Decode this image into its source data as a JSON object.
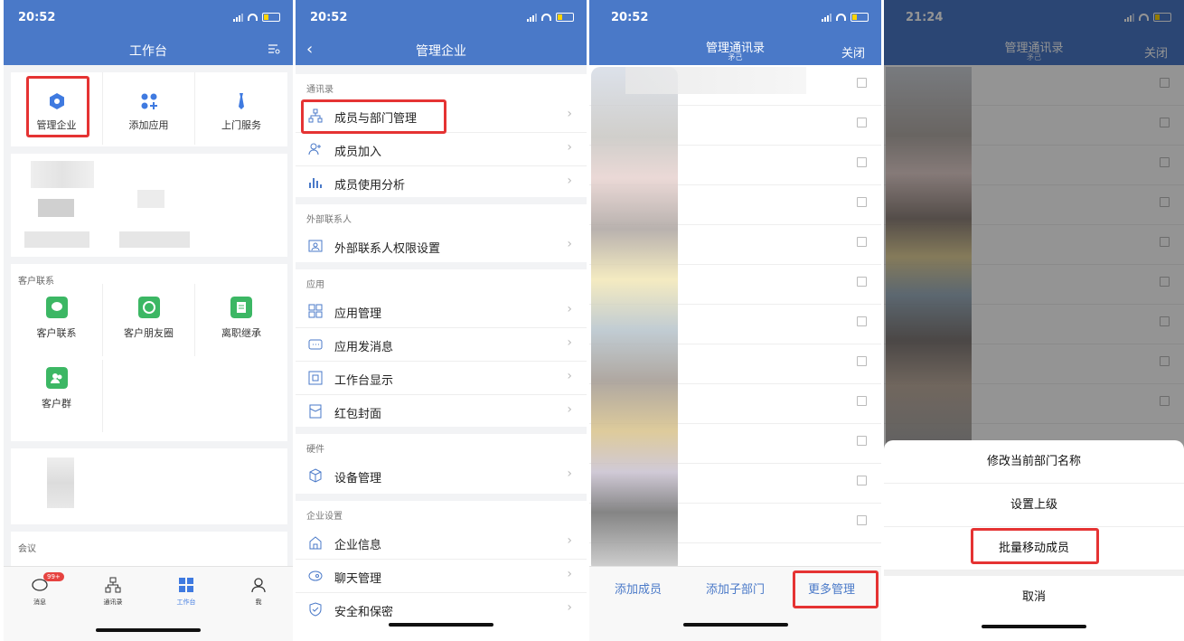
{
  "colors": {
    "accent": "#4a79c8",
    "highlight": "#e53333",
    "badge": "#e64340",
    "green": "#3cb764"
  },
  "phone1": {
    "time": "20:52",
    "title": "工作台",
    "top_apps": [
      "管理企业",
      "添加应用",
      "上门服务"
    ],
    "section_customer": "客户联系",
    "customer_apps": [
      "客户联系",
      "客户朋友圈",
      "离职继承",
      "客户群"
    ],
    "section_meeting": "会议",
    "tabs": [
      {
        "label": "消息",
        "icon": "chat-icon",
        "badge": "99+"
      },
      {
        "label": "通讯录",
        "icon": "org-chart-icon"
      },
      {
        "label": "工作台",
        "icon": "grid-icon"
      },
      {
        "label": "我",
        "icon": "person-icon"
      }
    ]
  },
  "phone2": {
    "time": "20:52",
    "title": "管理企业",
    "groups": [
      {
        "label": "通讯录",
        "items": [
          "成员与部门管理",
          "成员加入",
          "成员使用分析"
        ]
      },
      {
        "label": "外部联系人",
        "items": [
          "外部联系人权限设置"
        ]
      },
      {
        "label": "应用",
        "items": [
          "应用管理",
          "应用发消息",
          "工作台显示",
          "红包封面"
        ]
      },
      {
        "label": "硬件",
        "items": [
          "设备管理"
        ]
      },
      {
        "label": "企业设置",
        "items": [
          "企业信息",
          "聊天管理",
          "安全和保密"
        ]
      }
    ]
  },
  "phone3": {
    "time": "20:52",
    "title": "管理通讯录",
    "subtitle": "矛己",
    "close": "关闭",
    "bottom_buttons": [
      "添加成员",
      "添加子部门",
      "更多管理"
    ]
  },
  "phone4": {
    "time": "21:24",
    "title": "管理通讯录",
    "subtitle": "矛己",
    "close": "关闭",
    "sheet_items": [
      "修改当前部门名称",
      "设置上级",
      "批量移动成员"
    ],
    "cancel": "取消"
  }
}
